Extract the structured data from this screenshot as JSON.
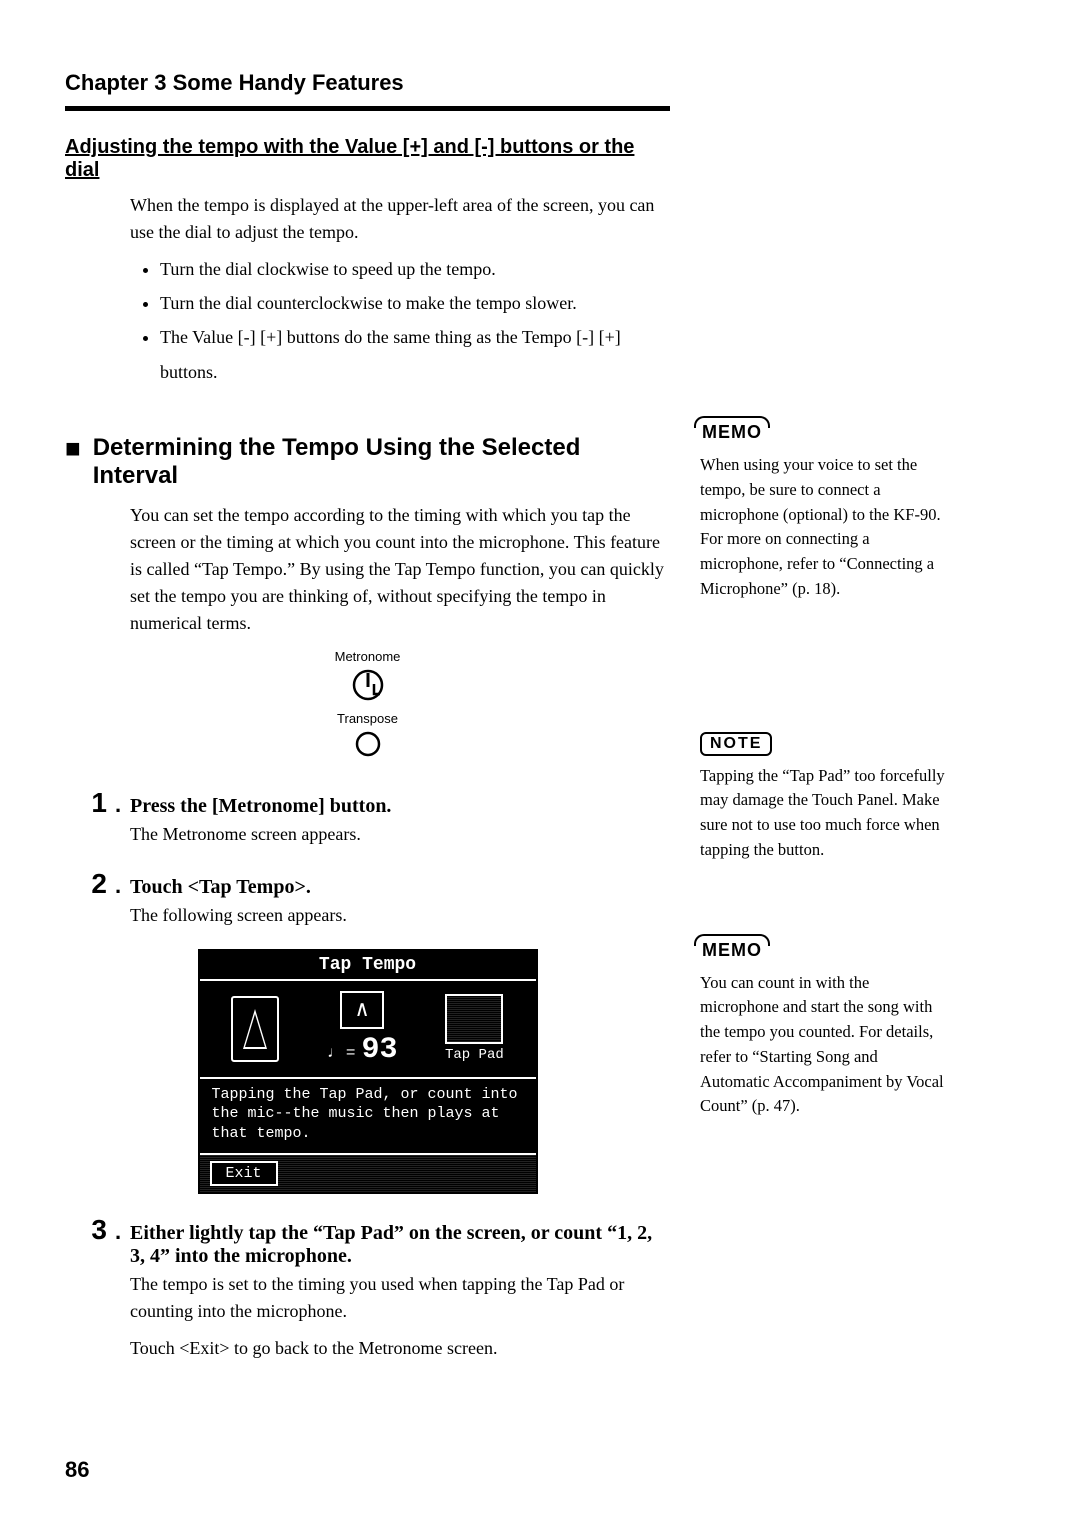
{
  "chapter": "Chapter 3  Some Handy Features",
  "subsection1": "Adjusting the tempo with the Value [+] and [-] buttons or the dial",
  "intro1": "When the tempo is displayed at the upper-left area of the screen, you can use the dial to adjust the tempo.",
  "bullets": [
    "Turn the dial clockwise to speed up the tempo.",
    "Turn the dial counterclockwise to make the tempo slower.",
    "The Value [-] [+] buttons do the same thing as the Tempo [-] [+] buttons."
  ],
  "section2": "Determining the Tempo Using the Selected Interval",
  "section2_body": "You can set the tempo according to the timing with which you tap the screen or the timing at which you count into the microphone. This feature is called “Tap Tempo.” By using the Tap Tempo function, you can quickly set the tempo you are thinking of, without specifying the tempo in numerical terms.",
  "diagram": {
    "top_label": "Metronome",
    "bottom_label": "Transpose"
  },
  "steps": [
    {
      "num": "1",
      "title": "Press the [Metronome] button.",
      "text": "The Metronome screen appears."
    },
    {
      "num": "2",
      "title": "Touch <Tap Tempo>.",
      "text": "The following screen appears."
    },
    {
      "num": "3",
      "title": "Either lightly tap the “Tap Pad” on the screen, or count “1, 2, 3, 4” into the microphone.",
      "text": "The tempo is set to the timing you used when tapping the Tap Pad or counting into the microphone."
    }
  ],
  "exit_line": "Touch <Exit> to go back to the Metronome screen.",
  "screen": {
    "title": "Tap Tempo",
    "bpm_prefix": "♩ =",
    "bpm": "93",
    "tap_pad": "Tap Pad",
    "instr": "Tapping the Tap Pad, or count into the mic--the music then plays at that tempo.",
    "exit": "Exit",
    "beat_glyph": "∧"
  },
  "side": {
    "memo_label": "MEMO",
    "note_label": "NOTE",
    "memo1": "When using your voice to set the tempo, be sure to connect a microphone (optional) to the KF-90. For more on connecting a microphone, refer to “Connecting a Microphone” (p. 18).",
    "note1": "Tapping the “Tap Pad” too forcefully may damage the Touch Panel. Make sure not to use too much force when tapping the button.",
    "memo2": "You can count in with the microphone and start the song with the tempo you counted. For details, refer to “Starting Song and Automatic Accompaniment by Vocal Count” (p. 47)."
  },
  "page_number": "86"
}
